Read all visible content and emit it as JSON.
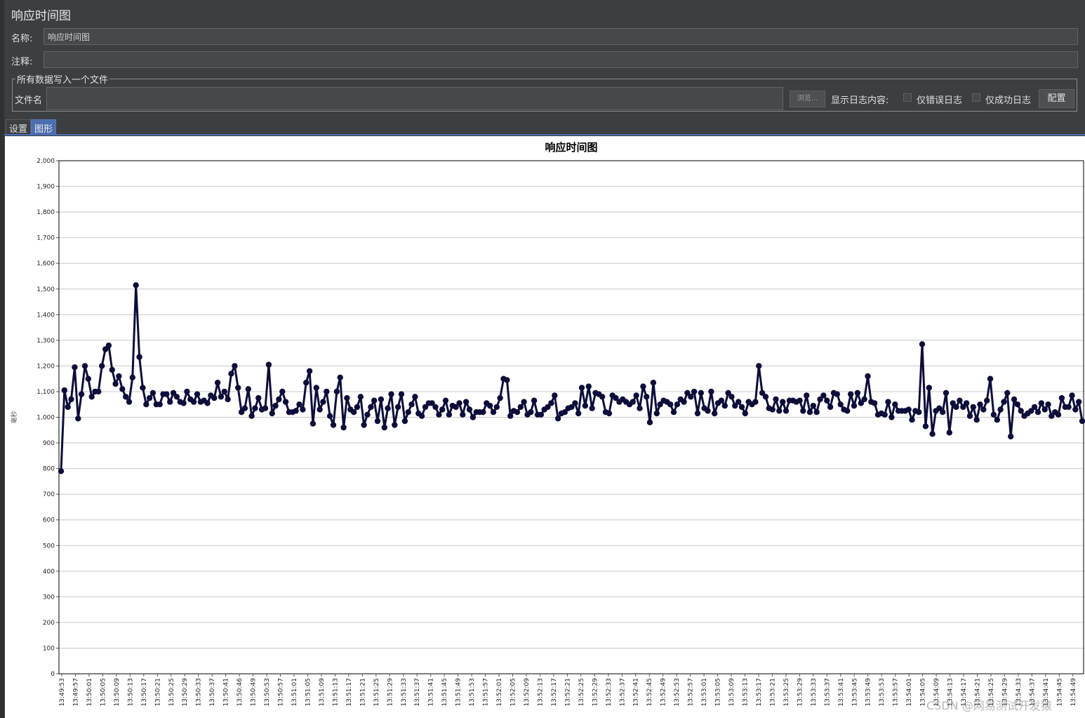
{
  "panel": {
    "title": "响应时间图"
  },
  "fields": {
    "name_label": "名称:",
    "name_value": "响应时间图",
    "comment_label": "注释:",
    "comment_value": ""
  },
  "file_group": {
    "legend": "所有数据写入一个文件",
    "filename_label": "文件名",
    "filename_value": "",
    "browse_label": "浏览...",
    "log_label": "显示日志内容:",
    "errors_only_label": "仅错误日志",
    "success_only_label": "仅成功日志",
    "config_label": "配置"
  },
  "tabs": [
    {
      "label": "设置",
      "selected": false
    },
    {
      "label": "图形",
      "selected": true
    }
  ],
  "colors": {
    "line": "#0d0d3a",
    "tab_selected": "#4b6eaf",
    "panel_bg": "#3c3f41"
  },
  "watermark": "CSDN @网易测试开发猿",
  "chart_data": {
    "type": "line",
    "title": "响应时间图",
    "ylabel": "毫秒",
    "ylim": [
      0,
      2000
    ],
    "y_ticks": [
      "0",
      "100",
      "200",
      "300",
      "400",
      "500",
      "600",
      "700",
      "800",
      "900",
      "1,000",
      "1,100",
      "1,200",
      "1,300",
      "1,400",
      "1,500",
      "1,600",
      "1,700",
      "1,800",
      "1,900",
      "2,000"
    ],
    "grid": true,
    "x_tick_labels": [
      "13:49:53",
      "13:49:57",
      "13:50:01",
      "13:50:05",
      "13:50:09",
      "13:50:13",
      "13:50:17",
      "13:50:21",
      "13:50:25",
      "13:50:29",
      "13:50:33",
      "13:50:37",
      "13:50:41",
      "13:50:46",
      "13:50:49",
      "13:50:53",
      "13:50:57",
      "13:51:01",
      "13:51:05",
      "13:51:09",
      "13:51:13",
      "13:51:17",
      "13:51:21",
      "13:51:25",
      "13:51:29",
      "13:51:33",
      "13:51:37",
      "13:51:41",
      "13:51:45",
      "13:51:49",
      "13:51:53",
      "13:51:57",
      "13:52:01",
      "13:52:05",
      "13:52:09",
      "13:52:13",
      "13:52:17",
      "13:52:21",
      "13:52:25",
      "13:52:29",
      "13:52:33",
      "13:52:37",
      "13:52:41",
      "13:52:45",
      "13:52:49",
      "13:52:53",
      "13:52:57",
      "13:53:01",
      "13:53:05",
      "13:53:09",
      "13:53:13",
      "13:53:17",
      "13:53:21",
      "13:53:25",
      "13:53:29",
      "13:53:33",
      "13:53:37",
      "13:53:41",
      "13:53:45",
      "13:53:49",
      "13:53:53",
      "13:53:57",
      "13:54:01",
      "13:54:05",
      "13:54:09",
      "13:54:13",
      "13:54:17",
      "13:54:21",
      "13:54:25",
      "13:54:29",
      "13:54:33",
      "13:54:37",
      "13:54:41",
      "13:54:45",
      "13:54:49"
    ],
    "series": [
      {
        "values": [
          790,
          1105,
          1040,
          1070,
          1195,
          995,
          1090,
          1200,
          1150,
          1080,
          1100,
          1100,
          1200,
          1265,
          1280,
          1185,
          1130,
          1160,
          1110,
          1080,
          1060,
          1155,
          1515,
          1235,
          1115,
          1050,
          1075,
          1095,
          1050,
          1050,
          1090,
          1090,
          1060,
          1095,
          1080,
          1060,
          1055,
          1100,
          1070,
          1060,
          1090,
          1060,
          1065,
          1055,
          1085,
          1075,
          1135,
          1080,
          1100,
          1070,
          1170,
          1200,
          1115,
          1020,
          1035,
          1110,
          1005,
          1035,
          1075,
          1030,
          1035,
          1205,
          1015,
          1045,
          1070,
          1100,
          1060,
          1020,
          1020,
          1025,
          1050,
          1030,
          1135,
          1180,
          975,
          1115,
          1030,
          1060,
          1100,
          1005,
          970,
          1100,
          1155,
          960,
          1075,
          1030,
          1020,
          1040,
          1080,
          970,
          1010,
          1040,
          1065,
          985,
          1070,
          960,
          1035,
          1090,
          970,
          1040,
          1090,
          985,
          1020,
          1050,
          1080,
          1015,
          1005,
          1040,
          1055,
          1055,
          1040,
          1010,
          1030,
          1065,
          1010,
          1045,
          1040,
          1055,
          1010,
          1060,
          1030,
          1000,
          1020,
          1020,
          1020,
          1055,
          1045,
          1020,
          1040,
          1075,
          1150,
          1145,
          1005,
          1025,
          1020,
          1040,
          1060,
          1010,
          1020,
          1065,
          1010,
          1010,
          1030,
          1040,
          1055,
          1085,
          995,
          1015,
          1020,
          1035,
          1040,
          1055,
          1015,
          1115,
          1045,
          1120,
          1035,
          1095,
          1090,
          1080,
          1020,
          1015,
          1085,
          1075,
          1060,
          1070,
          1060,
          1050,
          1060,
          1085,
          1035,
          1120,
          1080,
          980,
          1135,
          1015,
          1050,
          1065,
          1060,
          1050,
          1020,
          1050,
          1070,
          1060,
          1095,
          1080,
          1100,
          1015,
          1095,
          1035,
          1025,
          1100,
          1015,
          1055,
          1065,
          1045,
          1095,
          1080,
          1045,
          1060,
          1040,
          1015,
          1060,
          1050,
          1060,
          1200,
          1095,
          1080,
          1035,
          1030,
          1070,
          1025,
          1060,
          1025,
          1065,
          1065,
          1060,
          1065,
          1025,
          1085,
          1020,
          1045,
          1020,
          1070,
          1085,
          1065,
          1040,
          1095,
          1090,
          1050,
          1030,
          1025,
          1090,
          1045,
          1095,
          1055,
          1070,
          1160,
          1060,
          1055,
          1010,
          1015,
          1010,
          1060,
          1000,
          1050,
          1025,
          1025,
          1025,
          1030,
          990,
          1025,
          1020,
          1285,
          965,
          1115,
          935,
          1025,
          1035,
          1020,
          1095,
          940,
          1055,
          1040,
          1065,
          1040,
          1055,
          1005,
          1040,
          990,
          1050,
          1030,
          1065,
          1150,
          1010,
          990,
          1030,
          1060,
          1095,
          925,
          1070,
          1050,
          1025,
          1005,
          1015,
          1025,
          1040,
          1020,
          1055,
          1030,
          1050,
          1005,
          1020,
          1010,
          1075,
          1040,
          1040,
          1085,
          1030,
          1060,
          985
        ]
      }
    ]
  }
}
